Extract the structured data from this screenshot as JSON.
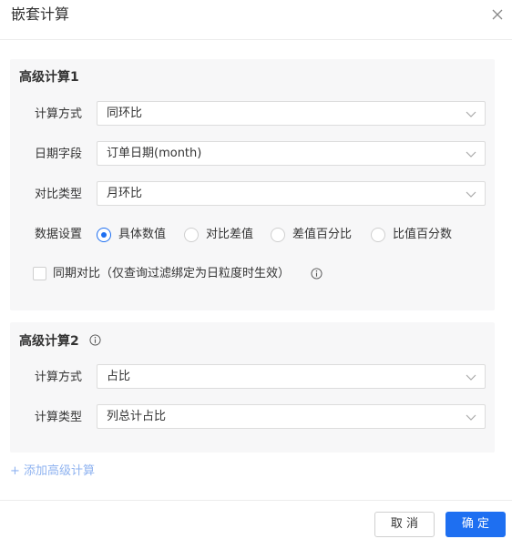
{
  "dialog": {
    "title": "嵌套计算",
    "close_icon": "close-icon"
  },
  "section1": {
    "title": "高级计算1",
    "rows": [
      {
        "label": "计算方式",
        "value": "同环比"
      },
      {
        "label": "日期字段",
        "value": "订单日期(month)"
      },
      {
        "label": "对比类型",
        "value": "月环比"
      }
    ],
    "data_setting": {
      "label": "数据设置",
      "options": [
        "具体数值",
        "对比差值",
        "差值百分比",
        "比值百分数"
      ],
      "selected": "具体数值"
    },
    "same_period": {
      "label": "同期对比（仅查询过滤绑定为日粒度时生效）",
      "checked": false,
      "info_icon": "info-icon"
    }
  },
  "section2": {
    "title": "高级计算2",
    "info_icon": "info-icon",
    "rows": [
      {
        "label": "计算方式",
        "value": "占比"
      },
      {
        "label": "计算类型",
        "value": "列总计占比"
      }
    ]
  },
  "add_link": "+ 添加高级计算",
  "footer": {
    "cancel_label": "取 消",
    "ok_label": "确 定"
  },
  "colors": {
    "accent": "#1e6ff1",
    "link": "#8fb3f0",
    "section_bg": "#f7f7f8"
  }
}
